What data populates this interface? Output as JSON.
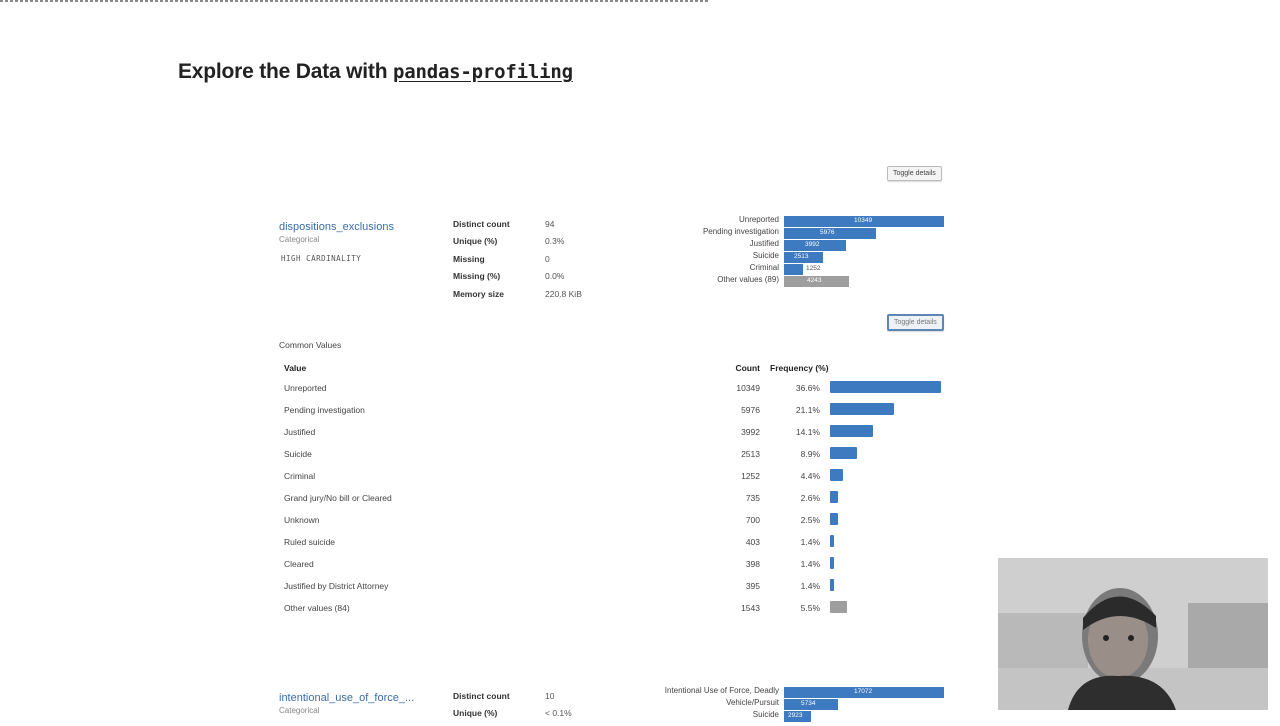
{
  "slide": {
    "title_prefix": "Explore the Data with ",
    "title_code": "pandas-profiling"
  },
  "toggle_top": "Toggle details",
  "toggle_mid": "Toggle details",
  "var1": {
    "name": "dispositions_exclusions",
    "type": "Categorical",
    "badge": "HIGH CARDINALITY",
    "stats": [
      {
        "label": "Distinct count",
        "value": "94"
      },
      {
        "label": "Unique (%)",
        "value": "0.3%"
      },
      {
        "label": "Missing",
        "value": "0"
      },
      {
        "label": "Missing (%)",
        "value": "0.0%"
      },
      {
        "label": "Memory size",
        "value": "220.8 KiB"
      }
    ],
    "mini_bars": [
      {
        "label": "Unreported",
        "count": 10349,
        "text": "10349",
        "other": false
      },
      {
        "label": "Pending investigation",
        "count": 5976,
        "text": "5976",
        "other": false
      },
      {
        "label": "Justified",
        "count": 3992,
        "text": "3992",
        "other": false
      },
      {
        "label": "Suicide",
        "count": 2513,
        "text": "2513",
        "other": false
      },
      {
        "label": "Criminal",
        "count": 1252,
        "text": "1252",
        "other": false
      },
      {
        "label": "Other values (89)",
        "count": 4200,
        "text": "4243",
        "other": true
      }
    ]
  },
  "common_values": {
    "title": "Common Values",
    "headers": {
      "value": "Value",
      "count": "Count",
      "frequency": "Frequency (%)"
    },
    "rows": [
      {
        "value": "Unreported",
        "count": "10349",
        "freq": "36.6%",
        "pct": 36.6,
        "other": false
      },
      {
        "value": "Pending investigation",
        "count": "5976",
        "freq": "21.1%",
        "pct": 21.1,
        "other": false
      },
      {
        "value": "Justified",
        "count": "3992",
        "freq": "14.1%",
        "pct": 14.1,
        "other": false
      },
      {
        "value": "Suicide",
        "count": "2513",
        "freq": "8.9%",
        "pct": 8.9,
        "other": false
      },
      {
        "value": "Criminal",
        "count": "1252",
        "freq": "4.4%",
        "pct": 4.4,
        "other": false
      },
      {
        "value": "Grand jury/No bill or Cleared",
        "count": "735",
        "freq": "2.6%",
        "pct": 2.6,
        "other": false
      },
      {
        "value": "Unknown",
        "count": "700",
        "freq": "2.5%",
        "pct": 2.5,
        "other": false
      },
      {
        "value": "Ruled suicide",
        "count": "403",
        "freq": "1.4%",
        "pct": 1.4,
        "other": false
      },
      {
        "value": "Cleared",
        "count": "398",
        "freq": "1.4%",
        "pct": 1.4,
        "other": false
      },
      {
        "value": "Justified by District Attorney",
        "count": "395",
        "freq": "1.4%",
        "pct": 1.4,
        "other": false
      },
      {
        "value": "Other values (84)",
        "count": "1543",
        "freq": "5.5%",
        "pct": 5.5,
        "other": true
      }
    ]
  },
  "var2": {
    "name": "intentional_use_of_force_...",
    "type": "Categorical",
    "stats": [
      {
        "label": "Distinct count",
        "value": "10"
      },
      {
        "label": "Unique (%)",
        "value": "< 0.1%"
      }
    ],
    "mini_bars": [
      {
        "label": "Intentional Use of Force, Deadly",
        "count": 17072,
        "text": "17072",
        "other": false
      },
      {
        "label": "Vehicle/Pursuit",
        "count": 5734,
        "text": "5734",
        "other": false
      },
      {
        "label": "Suicide",
        "count": 2923,
        "text": "2923",
        "other": false
      }
    ]
  },
  "colors": {
    "bar": "#3d7ac0",
    "other_bar": "#9e9e9e",
    "var_name": "#3b6ea5"
  }
}
